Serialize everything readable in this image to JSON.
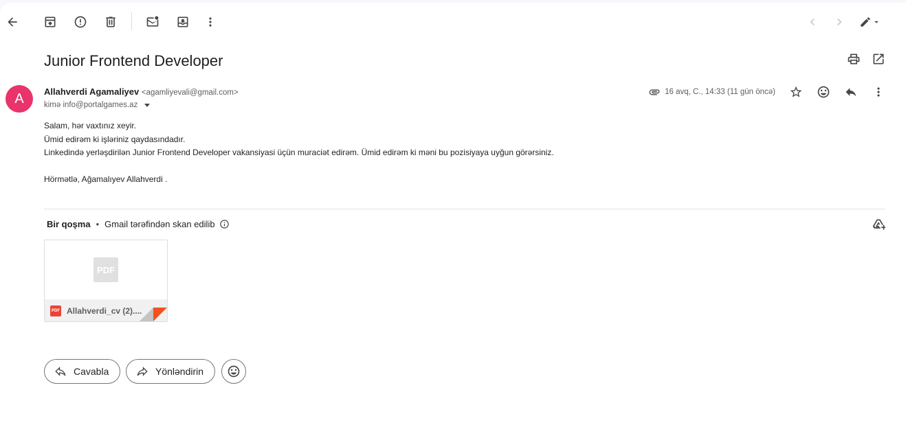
{
  "toolbar": {
    "back": "arrow-left-icon",
    "archive": "archive-icon",
    "spam": "report-spam-icon",
    "delete": "trash-icon",
    "mark_unread": "mark-unread-icon",
    "move": "move-to-icon",
    "more": "more-vert-icon"
  },
  "subject": "Junior Frontend Developer",
  "sender": {
    "avatar_letter": "A",
    "avatar_color": "#e8336b",
    "name": "Allahverdi Agamaliyev",
    "email": "<agamliyevali@gmail.com>",
    "to_line": "kimə info@portalgames.az",
    "date": "16 avq, C., 14:33 (11 gün öncə)"
  },
  "body": {
    "lines": [
      "Salam, hər vaxtınız xeyir.",
      "Ümid edirəm ki işləriniz qaydasındadır.",
      "Linkedində yerləşdirilən Junior Frontend Developer vakansiyasi üçün muraciət edirəm. Ümid edirəm ki məni bu pozisiyaya uyğun görərsiniz.",
      "",
      "Hörmətlə, Ağamalıyev Allahverdi ."
    ]
  },
  "attachments": {
    "count_label": "Bir qoşma",
    "separator": "•",
    "scan_label": "Gmail tərəfindən skan edilib",
    "file": {
      "name": "Allahverdi_cv (2)....",
      "type_badge": "PDF"
    }
  },
  "actions": {
    "reply": "Cavabla",
    "forward": "Yönləndirin"
  },
  "colors": {
    "accent_red": "#ea4335",
    "fold_orange": "#f4511e"
  }
}
